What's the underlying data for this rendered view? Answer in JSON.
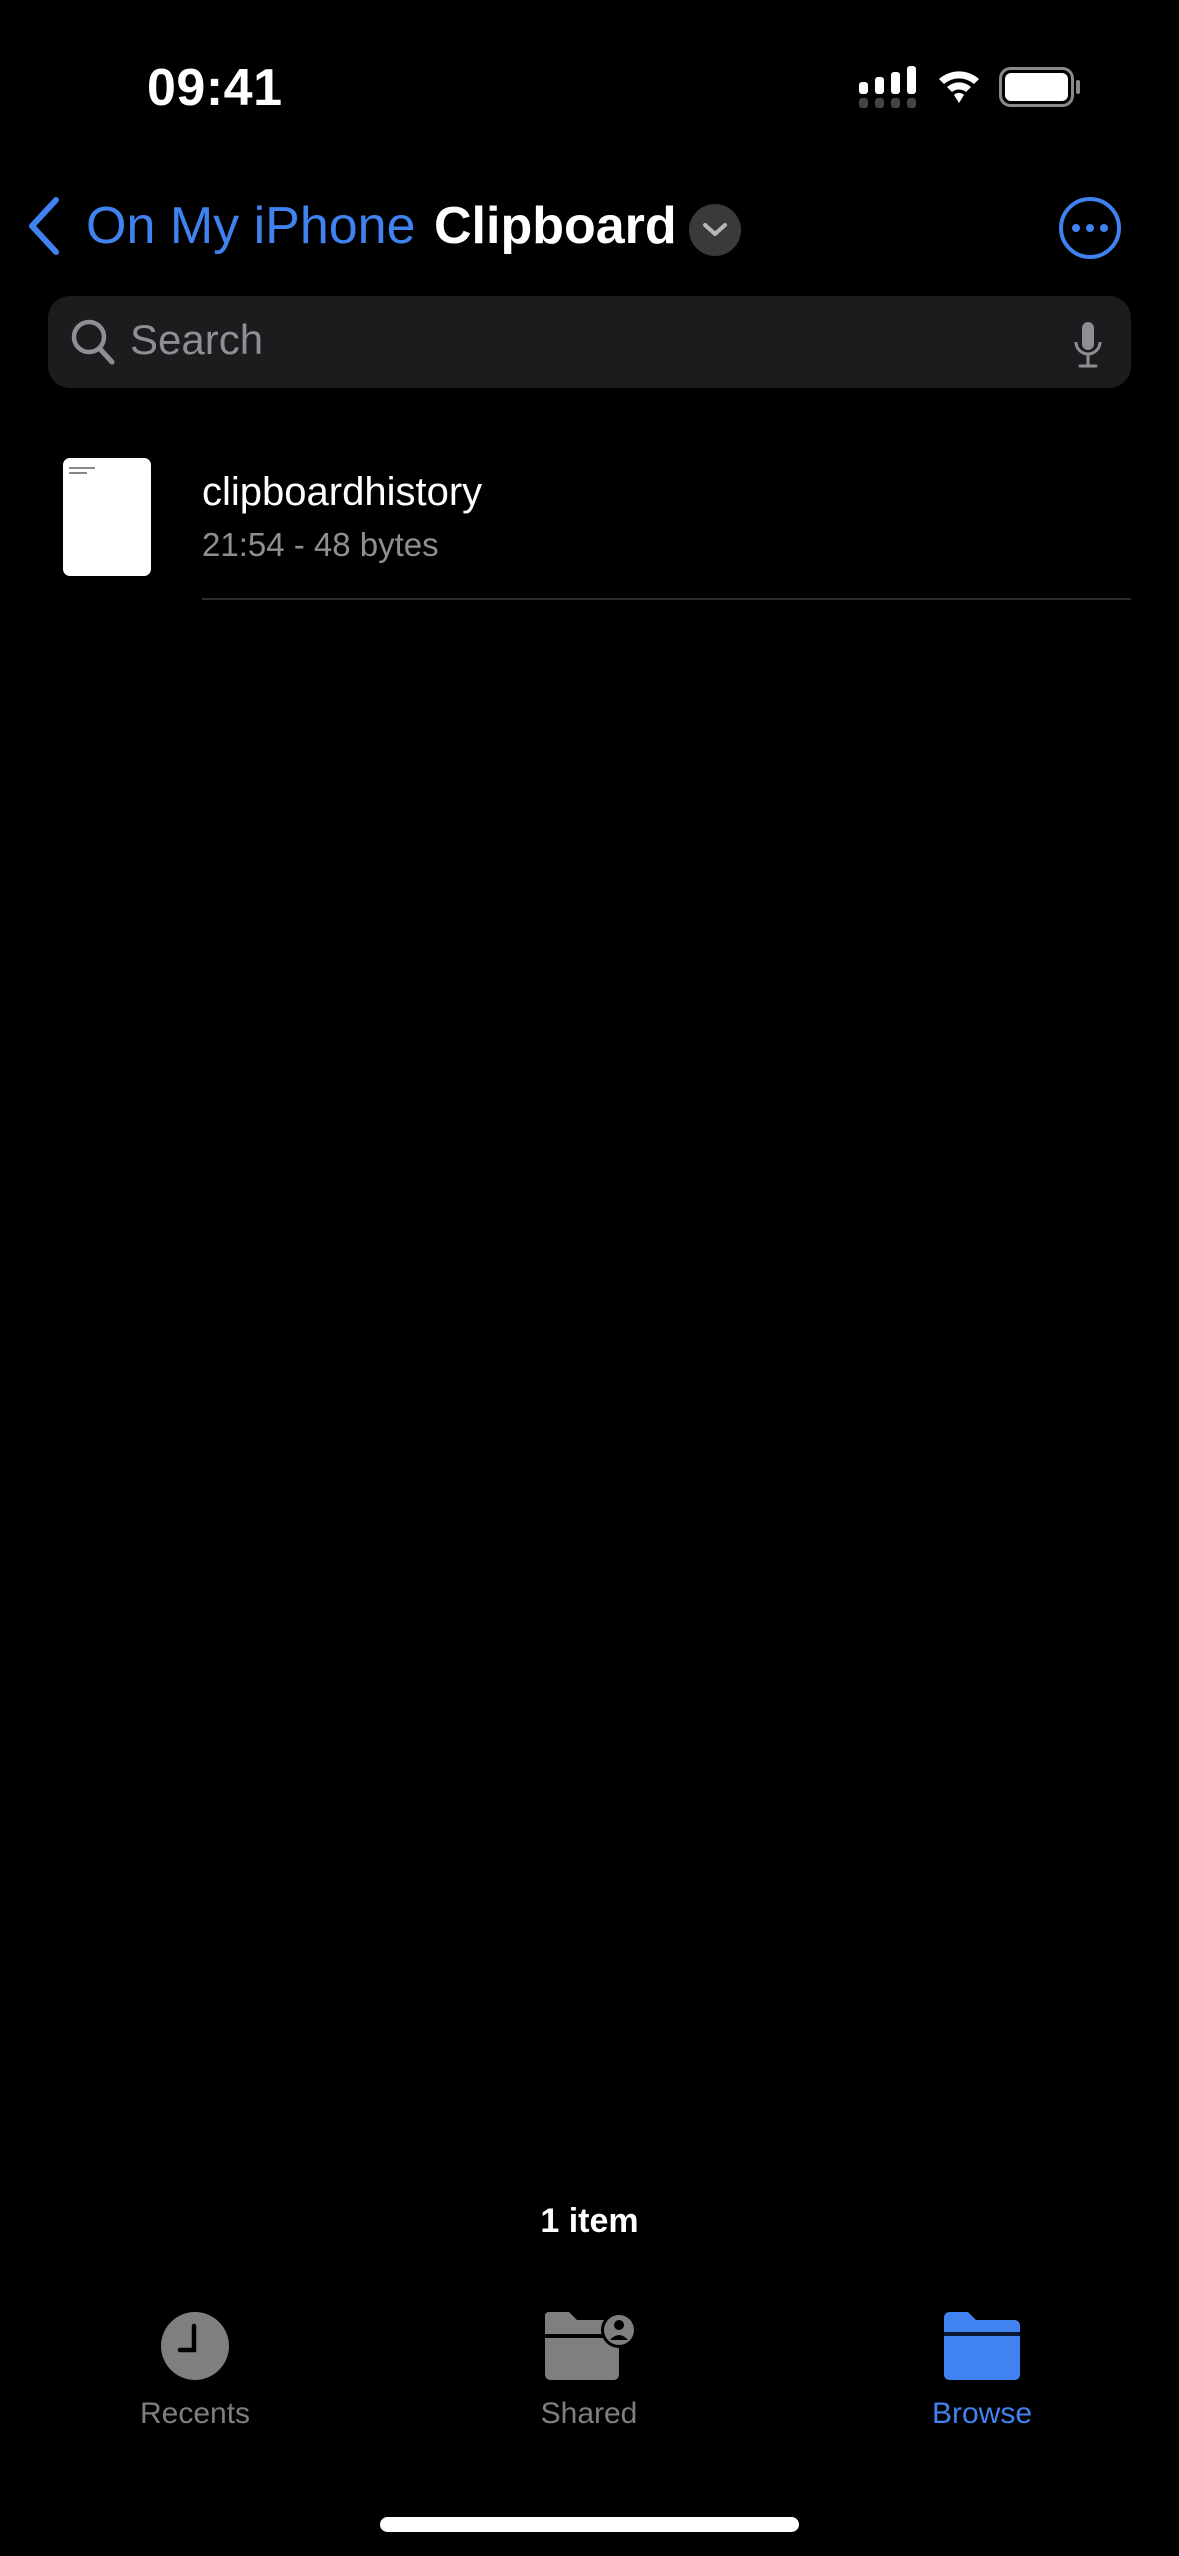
{
  "status_bar": {
    "time": "09:41"
  },
  "nav": {
    "back_label": "On My iPhone",
    "title": "Clipboard"
  },
  "search": {
    "placeholder": "Search"
  },
  "files": [
    {
      "name": "clipboardhistory",
      "meta": "21:54 - 48 bytes"
    }
  ],
  "footer": {
    "item_count": "1 item"
  },
  "tabbar": {
    "tabs": [
      {
        "label": "Recents",
        "icon": "clock-icon",
        "active": false
      },
      {
        "label": "Shared",
        "icon": "shared-folder-icon",
        "active": false
      },
      {
        "label": "Browse",
        "icon": "folder-icon",
        "active": true
      }
    ]
  },
  "colors": {
    "accent": "#3f82f0",
    "inactive": "#7f7f7f",
    "background": "#000000"
  }
}
